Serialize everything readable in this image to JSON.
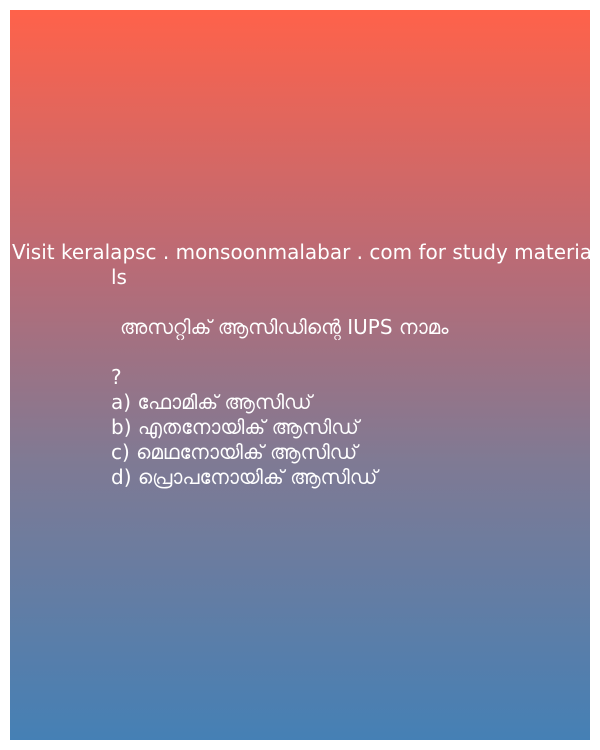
{
  "promo": {
    "line1": "Visit keralapsc . monsoonmalabar . com for study materia",
    "line2": "ls"
  },
  "question": {
    "text": "അസറ്റിക് ആസിഡിന്റെ IUPS നാമം",
    "mark": "?"
  },
  "options": [
    "a) ഫോമിക് ആസിഡ്",
    "b) എതനോയിക് ആസിഡ്",
    "c) മെഥനോയിക് ആസിഡ്",
    "d) പ്രൊപനോയിക് ആസിഡ്"
  ],
  "colors": {
    "gradient_top": "#ff624a",
    "gradient_bottom": "#4580b5",
    "text": "#ffffff"
  }
}
